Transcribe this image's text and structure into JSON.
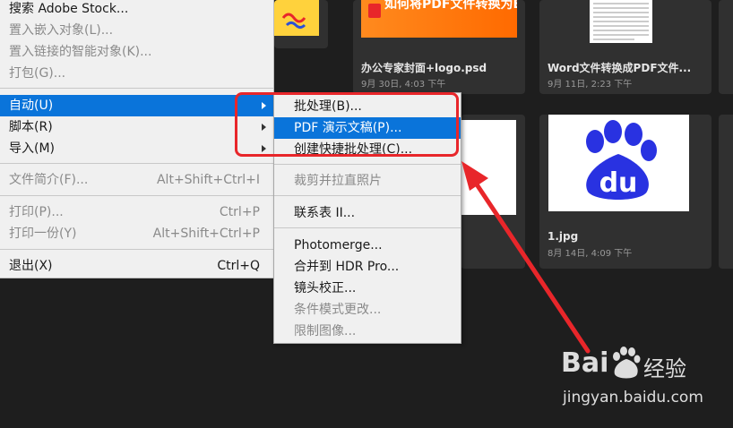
{
  "background": {
    "files": [
      {
        "name": "办公专家封面+logo.psd",
        "date": "9月 30日, 4:03 下午"
      },
      {
        "name": "Word文件转换成PDF文件...",
        "date": "9月 11日, 2:23 下午"
      },
      {
        "name": "1.jpg",
        "date": "8月 14日, 4:09 下午"
      }
    ],
    "thumb_banner_text": "如何将PDF文件转换为Excel",
    "baidu_thumb_text": "du"
  },
  "main_menu": {
    "items": [
      {
        "label": "搜索 Adobe Stock...",
        "shortcut": "",
        "disabled": false
      },
      {
        "label": "置入嵌入对象(L)...",
        "shortcut": "",
        "disabled": true
      },
      {
        "label": "置入链接的智能对象(K)...",
        "shortcut": "",
        "disabled": true
      },
      {
        "label": "打包(G)...",
        "shortcut": "",
        "disabled": true
      },
      {
        "label": "自动(U)",
        "shortcut": "",
        "disabled": false
      },
      {
        "label": "脚本(R)",
        "shortcut": "",
        "disabled": false
      },
      {
        "label": "导入(M)",
        "shortcut": "",
        "disabled": false
      },
      {
        "label": "文件简介(F)...",
        "shortcut": "Alt+Shift+Ctrl+I",
        "disabled": true
      },
      {
        "label": "打印(P)...",
        "shortcut": "Ctrl+P",
        "disabled": true
      },
      {
        "label": "打印一份(Y)",
        "shortcut": "Alt+Shift+Ctrl+P",
        "disabled": true
      },
      {
        "label": "退出(X)",
        "shortcut": "Ctrl+Q",
        "disabled": false
      }
    ]
  },
  "submenu": {
    "items": [
      {
        "label": "批处理(B)...",
        "disabled": false
      },
      {
        "label": "PDF 演示文稿(P)...",
        "disabled": false
      },
      {
        "label": "创建快捷批处理(C)...",
        "disabled": false
      },
      {
        "label": "裁剪并拉直照片",
        "disabled": true
      },
      {
        "label": "联系表 II...",
        "disabled": false
      },
      {
        "label": "Photomerge...",
        "disabled": false
      },
      {
        "label": "合并到 HDR Pro...",
        "disabled": false
      },
      {
        "label": "镜头校正...",
        "disabled": false
      },
      {
        "label": "条件模式更改...",
        "disabled": true
      },
      {
        "label": "限制图像...",
        "disabled": true
      }
    ]
  },
  "watermark": {
    "brand": "Bai",
    "suffix": "经验",
    "url": "jingyan.baidu.com"
  },
  "colors": {
    "highlight": "#0a74da",
    "annotation_red": "#e8262a",
    "baidu_blue": "#2932e1",
    "baidu_red": "#de1f26"
  }
}
